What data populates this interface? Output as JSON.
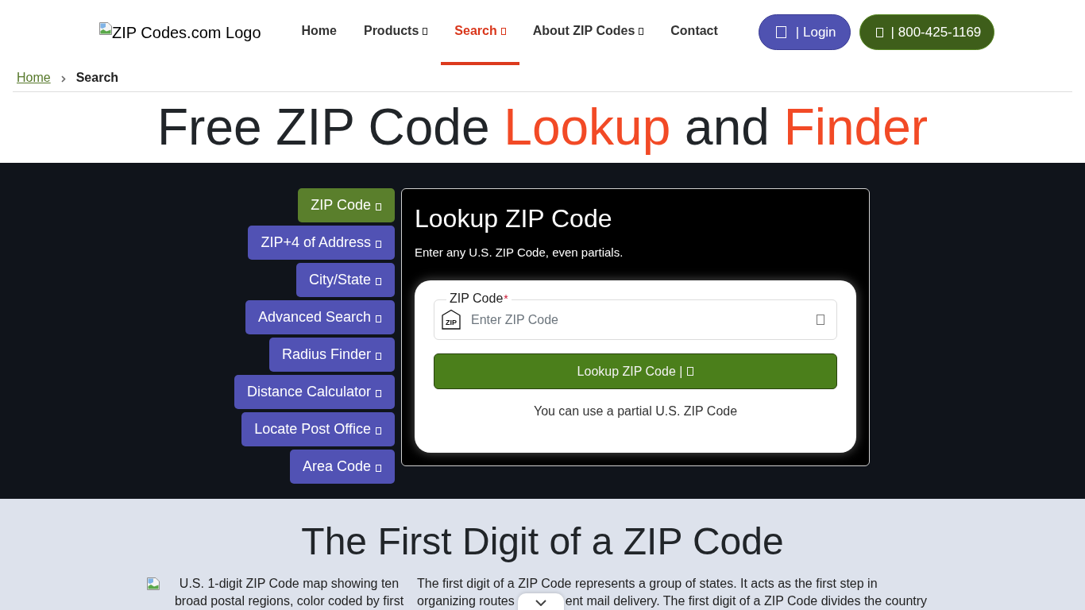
{
  "header": {
    "logo_alt": "ZIP Codes.com Logo",
    "nav": [
      {
        "label": "Home",
        "selected": false,
        "dropdown": false
      },
      {
        "label": "Products",
        "selected": false,
        "dropdown": true
      },
      {
        "label": "Search",
        "selected": true,
        "dropdown": true
      },
      {
        "label": "About ZIP Codes",
        "selected": false,
        "dropdown": true
      },
      {
        "label": "Contact",
        "selected": false,
        "dropdown": false
      }
    ],
    "buttons": [
      {
        "kind": "login",
        "label": "| Login"
      },
      {
        "kind": "phone",
        "label": "| 800-425-1169"
      }
    ]
  },
  "breadcrumb": [
    {
      "kind": "link",
      "label": "Home"
    },
    {
      "kind": "current",
      "label": "Search"
    }
  ],
  "title": [
    {
      "kind": "plain",
      "text": "Free ZIP Code"
    },
    {
      "kind": "accent",
      "text": "Lookup"
    },
    {
      "kind": "plain",
      "text": "and"
    },
    {
      "kind": "accent",
      "text": "Finder"
    }
  ],
  "search_tabs": [
    {
      "label": "ZIP Code",
      "selected": true
    },
    {
      "label": "ZIP+4 of Address",
      "selected": false
    },
    {
      "label": "City/State",
      "selected": false
    },
    {
      "label": "Advanced Search",
      "selected": false
    },
    {
      "label": "Radius Finder",
      "selected": false
    },
    {
      "label": "Distance Calculator",
      "selected": false
    },
    {
      "label": "Locate Post Office",
      "selected": false
    },
    {
      "label": "Area Code",
      "selected": false
    }
  ],
  "lookup_panel": {
    "title": "Lookup ZIP Code",
    "subtitle": "Enter any U.S. ZIP Code, even partials.",
    "field": {
      "label": "ZIP Code",
      "required_mark": "*",
      "icon_text": "ZIP",
      "placeholder": "Enter ZIP Code"
    },
    "button": "Lookup ZIP Code |",
    "hint": "You can use a partial U.S. ZIP Code"
  },
  "first_digit": {
    "title": "The First Digit of a ZIP Code",
    "map_alt": "U.S. 1-digit ZIP Code map showing ten broad postal regions, color coded by first",
    "paragraph": [
      "The first digit of a ZIP Code represents a group of states. It acts as the first step in",
      "organizing routes",
      "ent mail delivery. The first digit of a ZIP Code divides the country"
    ]
  }
}
